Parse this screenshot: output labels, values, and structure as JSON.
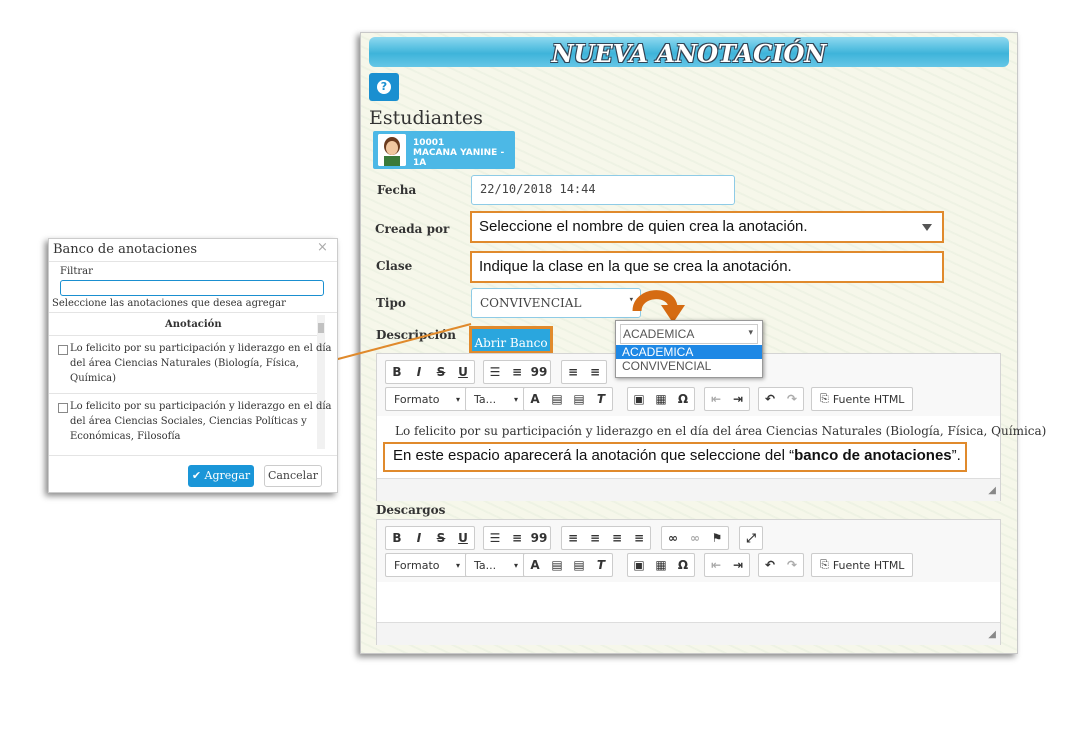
{
  "form": {
    "title": "NUEVA ANOTACIÓN",
    "help_icon": "question-circle-icon",
    "students_heading": "Estudiantes",
    "student": {
      "id": "10001",
      "name": "MACANA YANINE - 1A"
    },
    "fecha_label": "Fecha",
    "fecha_value": "22/10/2018 14:44",
    "creada_por_label": "Creada por",
    "creada_por_hint": "Seleccione el nombre de quien crea la anotación.",
    "clase_label": "Clase",
    "clase_hint": "Indique la clase en la que se crea la anotación.",
    "tipo_label": "Tipo",
    "tipo_value": "CONVIVENCIAL",
    "descripcion_label": "Descripción",
    "abrir_banco": "Abrir Banco",
    "descripcion_text": "Lo felicito por su participación y liderazgo en el día del área Ciencias Naturales (Biología, Física, Química)",
    "descripcion_hint_prefix": "En este espacio aparecerá la anotación que seleccione del “",
    "descripcion_hint_bold": "banco de anotaciones",
    "descripcion_hint_suffix": "”.",
    "descargos_label": "Descargos"
  },
  "toolbar": {
    "bold": "B",
    "italic": "I",
    "strike": "S",
    "underline": "U",
    "quote": "99",
    "format": "Formato",
    "size": "Ta...",
    "omega": "Ω",
    "source": "Fuente HTML"
  },
  "dropdown": {
    "current": "ACADEMICA",
    "options": [
      "ACADEMICA",
      "CONVIVENCIAL"
    ],
    "highlighted": "ACADEMICA"
  },
  "modal": {
    "title": "Banco de anotaciones",
    "close": "×",
    "filter_label": "Filtrar",
    "filter_value": "",
    "instruction": "Seleccione las anotaciones que desea agregar",
    "column_header": "Anotación",
    "items": [
      {
        "line1": "Lo felicito por su participación y liderazgo en el día",
        "line2": "del área Ciencias Naturales (Biología, Física,",
        "line3": "Química)"
      },
      {
        "line1": "Lo felicito por su participación y liderazgo en el día",
        "line2": "del área Ciencias Sociales, Ciencias Políticas y",
        "line3": "Económicas, Filosofía"
      }
    ],
    "agregar": "✔ Agregar",
    "cancelar": "Cancelar"
  },
  "colors": {
    "accent": "#2aa6de",
    "highlight": "#e08a2c",
    "selected": "#1e88e5"
  }
}
